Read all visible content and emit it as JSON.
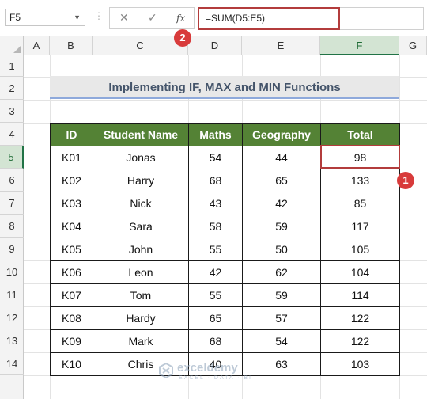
{
  "formula_bar": {
    "name_box": "F5",
    "cancel_glyph": "✕",
    "enter_glyph": "✓",
    "fx_label": "fx",
    "formula": "=SUM(D5:E5)"
  },
  "columns": [
    "A",
    "B",
    "C",
    "D",
    "E",
    "F",
    "G"
  ],
  "rows": [
    "1",
    "2",
    "3",
    "4",
    "5",
    "6",
    "7",
    "8",
    "9",
    "10",
    "11",
    "12",
    "13",
    "14"
  ],
  "active_cell": {
    "column": "F",
    "row": "5"
  },
  "sheet_title": "Implementing IF, MAX and MIN Functions",
  "table": {
    "headers": [
      "ID",
      "Student Name",
      "Maths",
      "Geography",
      "Total"
    ],
    "rows": [
      [
        "K01",
        "Jonas",
        "54",
        "44",
        "98"
      ],
      [
        "K02",
        "Harry",
        "68",
        "65",
        "133"
      ],
      [
        "K03",
        "Nick",
        "43",
        "42",
        "85"
      ],
      [
        "K04",
        "Sara",
        "58",
        "59",
        "117"
      ],
      [
        "K05",
        "John",
        "55",
        "50",
        "105"
      ],
      [
        "K06",
        "Leon",
        "42",
        "62",
        "104"
      ],
      [
        "K07",
        "Tom",
        "55",
        "59",
        "114"
      ],
      [
        "K08",
        "Hardy",
        "65",
        "57",
        "122"
      ],
      [
        "K09",
        "Mark",
        "68",
        "54",
        "122"
      ],
      [
        "K10",
        "Chris",
        "40",
        "63",
        "103"
      ]
    ]
  },
  "markers": {
    "one": "1",
    "two": "2"
  },
  "watermark": {
    "name": "exceldemy",
    "tagline": "EXCEL · DATA · BI"
  },
  "colors": {
    "header_fill": "#548235",
    "highlight": "#b33c3c",
    "marker": "#d83b3b",
    "title_text": "#44546a"
  }
}
